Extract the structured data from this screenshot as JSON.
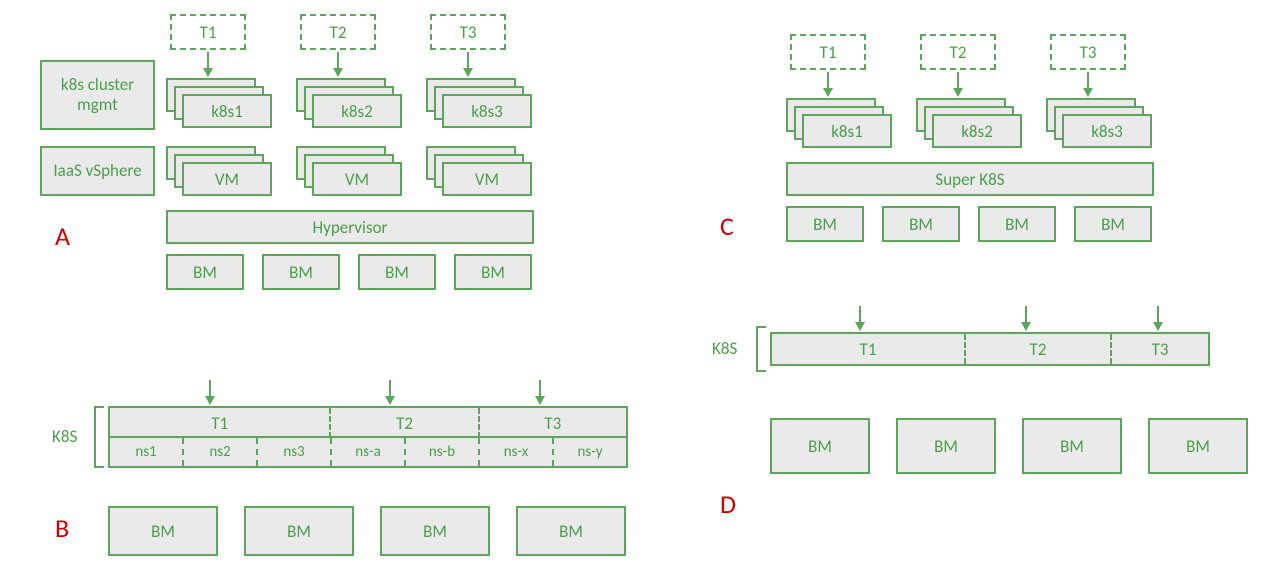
{
  "colors": {
    "accent": "#5da55d",
    "fill": "#eaeaea",
    "label_red": "#d00000"
  },
  "panels": {
    "A": {
      "label": "A",
      "tenants": [
        "T1",
        "T2",
        "T3"
      ],
      "k8s_clusters": [
        "k8s1",
        "k8s2",
        "k8s3"
      ],
      "vms": [
        "VM",
        "VM",
        "VM"
      ],
      "side_boxes": [
        "k8s cluster mgmt",
        "IaaS vSphere"
      ],
      "hypervisor": "Hypervisor",
      "bms": [
        "BM",
        "BM",
        "BM",
        "BM"
      ]
    },
    "B": {
      "label": "B",
      "k8s_label": "K8S",
      "tenants": [
        "T1",
        "T2",
        "T3"
      ],
      "namespaces": [
        "ns1",
        "ns2",
        "ns3",
        "ns-a",
        "ns-b",
        "ns-x",
        "ns-y"
      ],
      "bms": [
        "BM",
        "BM",
        "BM",
        "BM"
      ]
    },
    "C": {
      "label": "C",
      "tenants": [
        "T1",
        "T2",
        "T3"
      ],
      "k8s_clusters": [
        "k8s1",
        "k8s2",
        "k8s3"
      ],
      "super_k8s": "Super K8S",
      "bms": [
        "BM",
        "BM",
        "BM",
        "BM"
      ]
    },
    "D": {
      "label": "D",
      "k8s_label": "K8S",
      "tenants": [
        "T1",
        "T2",
        "T3"
      ],
      "bms": [
        "BM",
        "BM",
        "BM",
        "BM"
      ]
    }
  }
}
